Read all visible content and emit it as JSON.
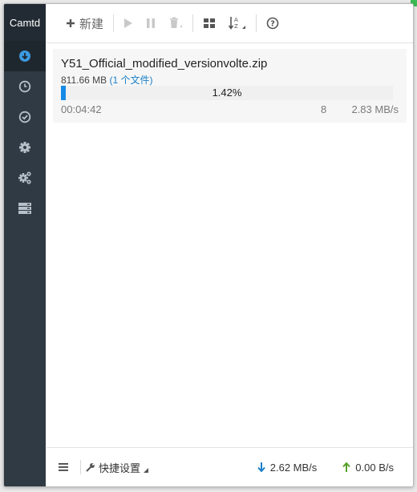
{
  "app": {
    "brand": "Camtd"
  },
  "sidebar": {
    "items": [
      {
        "name": "download-icon",
        "active": true
      },
      {
        "name": "clock-icon",
        "active": false
      },
      {
        "name": "check-icon",
        "active": false
      },
      {
        "name": "gear-icon",
        "active": false
      },
      {
        "name": "gears-icon",
        "active": false
      },
      {
        "name": "server-icon",
        "active": false
      }
    ]
  },
  "toolbar": {
    "new_label": "新建"
  },
  "task": {
    "name": "Y51_Official_modified_versionvolte.zip",
    "size": "811.66 MB",
    "files": "(1 个文件)",
    "progress_text": "1.42%",
    "progress_fraction": 0.0142,
    "elapsed": "00:04:42",
    "connections": "8",
    "speed": "2.83 MB/s"
  },
  "footer": {
    "quick_settings": "快捷设置",
    "download_speed": "2.62 MB/s",
    "upload_speed": "0.00 B/s"
  },
  "colors": {
    "sidebar_bg": "#2f3a44",
    "accent": "#1689e6",
    "down_arrow": "#1a7ec8",
    "up_arrow": "#5aa02c"
  }
}
